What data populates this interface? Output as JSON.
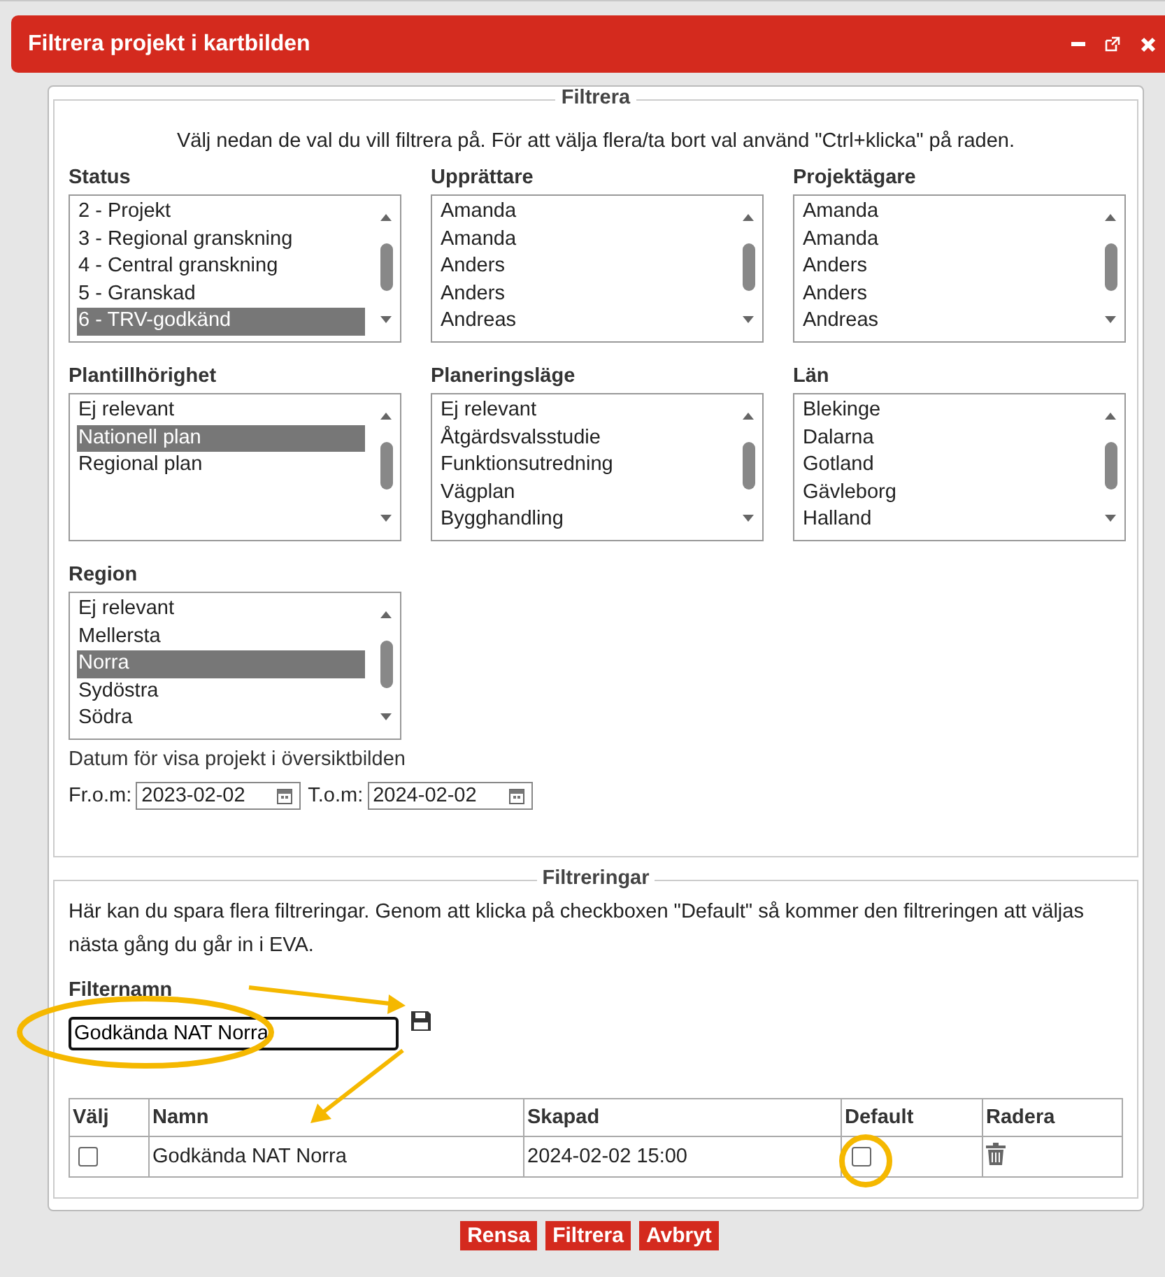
{
  "window": {
    "title": "Filtrera projekt i kartbilden"
  },
  "filter_section": {
    "legend": "Filtrera",
    "instruction": "Välj nedan de val du vill filtrera på. För att välja flera/ta bort val använd \"Ctrl+klicka\" på raden.",
    "lists": [
      {
        "label": "Status",
        "items": [
          {
            "text": "2 - Projekt",
            "selected": false
          },
          {
            "text": "3 - Regional granskning",
            "selected": false
          },
          {
            "text": "4 - Central granskning",
            "selected": false
          },
          {
            "text": "5 - Granskad",
            "selected": false
          },
          {
            "text": "6 - TRV-godkänd",
            "selected": true
          }
        ]
      },
      {
        "label": "Upprättare",
        "items": [
          {
            "text": "Amanda",
            "selected": false
          },
          {
            "text": "Amanda",
            "selected": false
          },
          {
            "text": "Anders",
            "selected": false
          },
          {
            "text": "Anders",
            "selected": false
          },
          {
            "text": "Andreas",
            "selected": false
          }
        ]
      },
      {
        "label": "Projektägare",
        "items": [
          {
            "text": "Amanda",
            "selected": false
          },
          {
            "text": "Amanda",
            "selected": false
          },
          {
            "text": "Anders",
            "selected": false
          },
          {
            "text": "Anders",
            "selected": false
          },
          {
            "text": "Andreas",
            "selected": false
          }
        ]
      },
      {
        "label": "Plantillhörighet",
        "items": [
          {
            "text": "Ej relevant",
            "selected": false
          },
          {
            "text": "Nationell plan",
            "selected": true
          },
          {
            "text": "Regional plan",
            "selected": false
          }
        ]
      },
      {
        "label": "Planeringsläge",
        "items": [
          {
            "text": "Ej relevant",
            "selected": false
          },
          {
            "text": "Åtgärdsvalsstudie",
            "selected": false
          },
          {
            "text": "Funktionsutredning",
            "selected": false
          },
          {
            "text": "Vägplan",
            "selected": false
          },
          {
            "text": "Bygghandling",
            "selected": false
          }
        ]
      },
      {
        "label": "Län",
        "items": [
          {
            "text": "Blekinge",
            "selected": false
          },
          {
            "text": "Dalarna",
            "selected": false
          },
          {
            "text": "Gotland",
            "selected": false
          },
          {
            "text": "Gävleborg",
            "selected": false
          },
          {
            "text": "Halland",
            "selected": false
          }
        ]
      },
      {
        "label": "Region",
        "items": [
          {
            "text": "Ej relevant",
            "selected": false
          },
          {
            "text": "Mellersta",
            "selected": false
          },
          {
            "text": "Norra",
            "selected": true
          },
          {
            "text": "Sydöstra",
            "selected": false
          },
          {
            "text": "Södra",
            "selected": false
          }
        ]
      }
    ],
    "date_caption": "Datum för visa projekt i översiktbilden",
    "dates": [
      {
        "label": "Fr.o.m:",
        "value": "2023-02-02"
      },
      {
        "label": "T.o.m:",
        "value": "2024-02-02"
      }
    ]
  },
  "saved_section": {
    "legend": "Filtreringar",
    "description": "Här kan du spara flera filtreringar. Genom att klicka på checkboxen \"Default\" så kommer den filtreringen att väljas nästa gång du går in i EVA.",
    "name_label": "Filternamn",
    "name_value": "Godkända NAT Norra",
    "table": {
      "columns": [
        "Välj",
        "Namn",
        "Skapad",
        "Default",
        "Radera"
      ],
      "rows": [
        {
          "checked": false,
          "name": "Godkända NAT Norra",
          "created": "2024-02-02 15:00",
          "default": false
        }
      ]
    }
  },
  "buttons": [
    "Rensa",
    "Filtrera",
    "Avbryt"
  ]
}
